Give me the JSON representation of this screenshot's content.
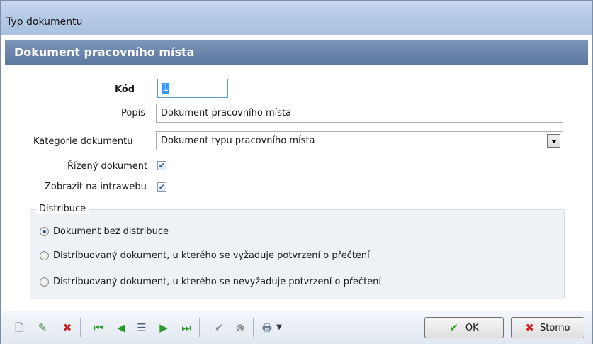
{
  "window": {
    "title": "Typ dokumentu"
  },
  "header": {
    "title": "Dokument pracovního místa"
  },
  "form": {
    "code_label": "Kód",
    "code_value": "1",
    "description_label": "Popis",
    "description_value": "Dokument pracovního místa",
    "category_label": "Kategorie dokumentu",
    "category_value": "Dokument typu pracovního místa",
    "controlled_label": "Řízený dokument",
    "controlled_checked": true,
    "intranet_label": "Zobrazit na intrawebu",
    "intranet_checked": true
  },
  "distribution": {
    "legend": "Distribuce",
    "options": [
      {
        "label": "Dokument bez distribuce",
        "selected": true
      },
      {
        "label": "Distribuovaný dokument, u kterého se vyžaduje potvrzení o přečtení",
        "selected": false
      },
      {
        "label": "Distribuovaný dokument, u kterého se nevyžaduje potvrzení o přečtení",
        "selected": false
      }
    ]
  },
  "toolbar": {
    "icons": [
      "new-document-icon",
      "edit-document-icon",
      "delete-document-icon",
      "first-record-icon",
      "previous-record-icon",
      "list-icon",
      "next-record-icon",
      "last-record-icon",
      "confirm-icon",
      "cancel-icon",
      "print-icon"
    ],
    "ok_label": "OK",
    "cancel_label": "Storno",
    "ok_color": "#2e9b2e",
    "cancel_color": "#d11f1f"
  },
  "colors": {
    "header": "#6a84ab",
    "titlebar": "#b9cce6"
  }
}
